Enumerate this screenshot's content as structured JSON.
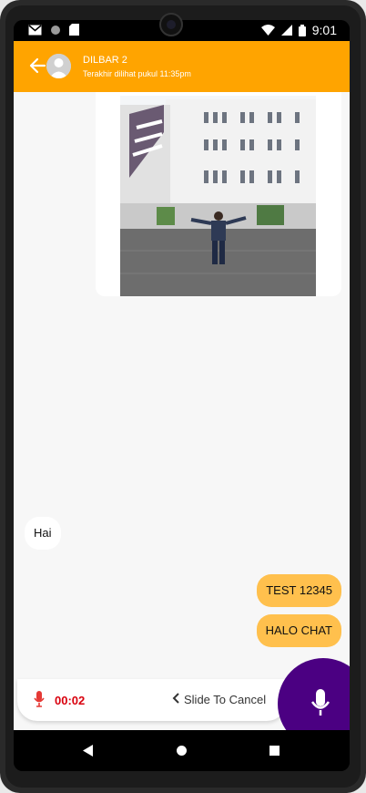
{
  "status_bar": {
    "time": "9:01",
    "left_icons": [
      "gmail-icon",
      "circle-icon",
      "sd-card-icon"
    ],
    "right_icons": [
      "wifi-icon",
      "signal-icon",
      "battery-icon"
    ]
  },
  "header": {
    "contact_name": "DILBAR 2",
    "last_seen": "Terakhir dilihat pukul 11:35pm",
    "back_icon": "arrow-back-icon",
    "avatar_icon": "default-avatar-icon"
  },
  "messages": {
    "image_message": {
      "type": "image",
      "icon": "photo-building-person"
    },
    "incoming": [
      {
        "text": "Hai"
      }
    ],
    "outgoing": [
      {
        "text": "TEST 12345"
      },
      {
        "text": "HALO CHAT"
      }
    ]
  },
  "recorder": {
    "timer": "00:02",
    "slide_hint": "Slide To Cancel",
    "mic_icon": "mic-icon"
  },
  "colors": {
    "app_bar": "#ffa400",
    "outgoing_bubble": "#ffc04d",
    "fab": "#4b0082",
    "timer": "#d9000d"
  }
}
